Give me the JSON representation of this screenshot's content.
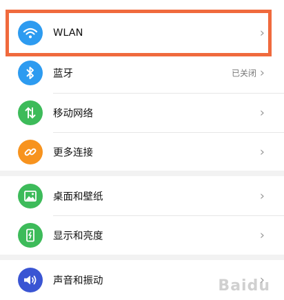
{
  "settings": {
    "items": [
      {
        "label": "WLAN",
        "icon": "wifi-icon",
        "color": "#2d9bf0"
      },
      {
        "label": "蓝牙",
        "icon": "bluetooth-icon",
        "color": "#2d9bf0",
        "status": "已关闭"
      },
      {
        "label": "移动网络",
        "icon": "mobile-data-icon",
        "color": "#3dbb5a"
      },
      {
        "label": "更多连接",
        "icon": "link-icon",
        "color": "#f7931e"
      },
      {
        "label": "桌面和壁纸",
        "icon": "wallpaper-icon",
        "color": "#3dbb5a"
      },
      {
        "label": "显示和亮度",
        "icon": "display-icon",
        "color": "#3dbb5a"
      },
      {
        "label": "声音和振动",
        "icon": "sound-icon",
        "color": "#3a55d3"
      }
    ]
  },
  "highlight_color": "#f06a3d",
  "watermark": "Baidu"
}
